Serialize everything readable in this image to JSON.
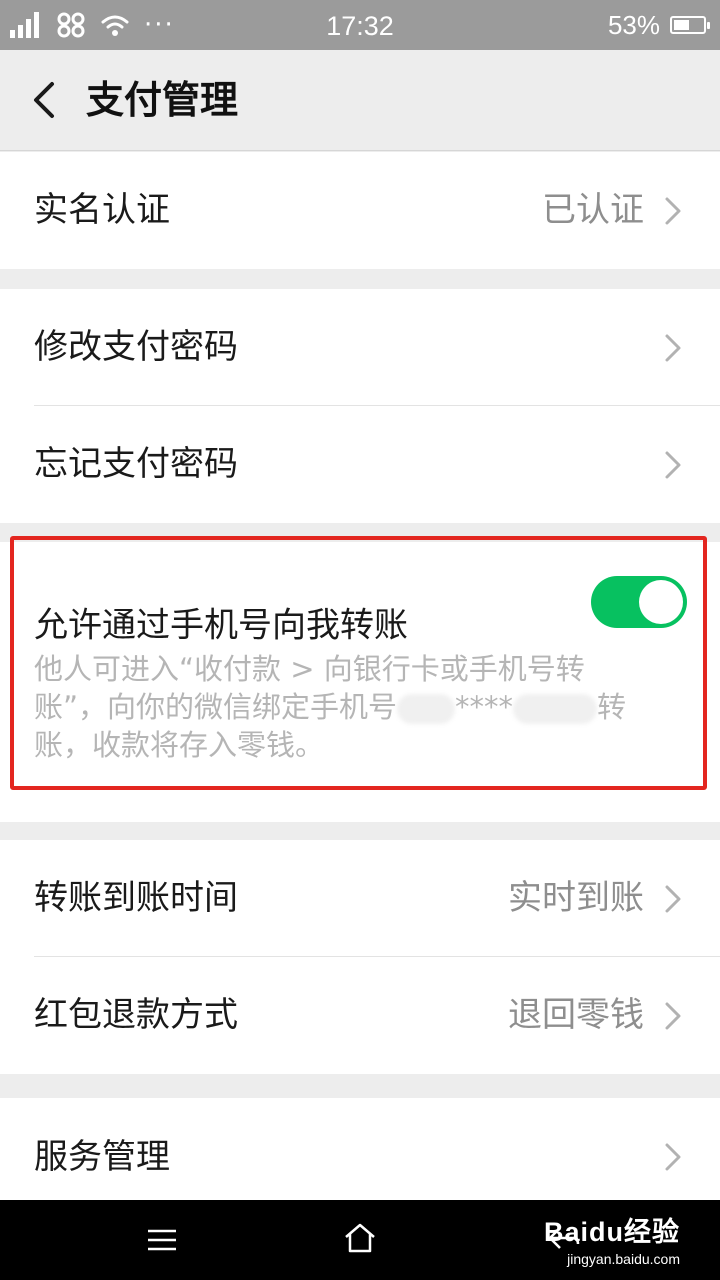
{
  "status_bar": {
    "time": "17:32",
    "battery": "53%",
    "battery_level": 0.53,
    "dots": "···"
  },
  "header": {
    "title": "支付管理"
  },
  "groups": {
    "realname": {
      "label": "实名认证",
      "value": "已认证"
    },
    "password": {
      "change_label": "修改支付密码",
      "forgot_label": "忘记支付密码"
    },
    "phone_transfer": {
      "label": "允许通过手机号向我转账",
      "enabled": true,
      "desc_line1": "他人可进入“收付款 > 向银行卡或手机号转",
      "desc_line2_a": "账”，向你的微信绑定手机号",
      "desc_line2_b": "****",
      "desc_line2_c": "转",
      "desc_line3": "账，收款将存入零钱。"
    },
    "transfer": {
      "arrival_label": "转账到账时间",
      "arrival_value": "实时到账",
      "refund_label": "红包退款方式",
      "refund_value": "退回零钱"
    },
    "service": {
      "label": "服务管理"
    }
  },
  "watermark": {
    "brand": "Baidu经验",
    "url": "jingyan.baidu.com"
  },
  "colors": {
    "toggle_on": "#07c160",
    "highlight": "#e3261f",
    "status_bar": "#9b9b9b"
  }
}
